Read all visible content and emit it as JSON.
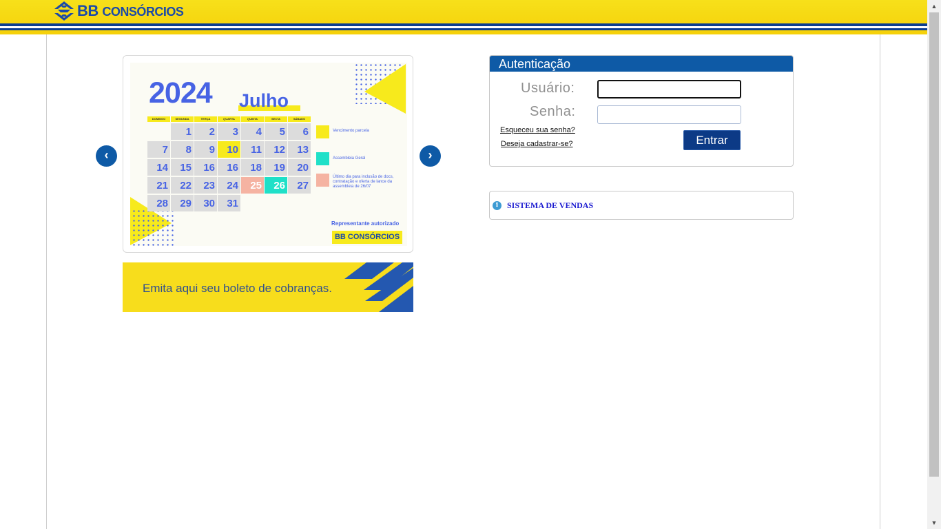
{
  "header": {
    "logo_text_main": "BB ",
    "logo_text_sc": "CONSÓRCIOS",
    "logo_icon": "bb-logo-icon",
    "brand_yellow": "#f5d10a",
    "brand_blue": "#0b3d91"
  },
  "carousel": {
    "prev_label": "‹",
    "next_label": "›",
    "calendar": {
      "year": "2024",
      "month": "Julho",
      "weekdays": [
        "DOMINGO",
        "SEGUNDA",
        "TERÇA",
        "QUARTA",
        "QUINTA",
        "SEXTA",
        "SÁBADO"
      ],
      "weeks": [
        [
          "",
          "1",
          "2",
          "3",
          "4",
          "5",
          "6"
        ],
        [
          "7",
          "8",
          "9",
          "10",
          "11",
          "12",
          "13"
        ],
        [
          "14",
          "15",
          "16",
          "16",
          "18",
          "19",
          "20"
        ],
        [
          "21",
          "22",
          "23",
          "24",
          "25",
          "26",
          "27"
        ],
        [
          "28",
          "29",
          "30",
          "31",
          "",
          "",
          ""
        ]
      ],
      "legend": [
        {
          "text": "Vencimento parcela",
          "color": "#f7ea1c"
        },
        {
          "text": "Assembleia Geral",
          "color": "#1fe0c8"
        },
        {
          "text": "Último dia para inclusão de docs, contratação e oferta de lance da assembleia de 26/07",
          "color": "#f5b3a2"
        }
      ],
      "representative": "Representante autorizado",
      "rep_logo": "BB CONSÓRCIOS"
    }
  },
  "boleto": {
    "text": "Emita aqui seu boleto de cobranças."
  },
  "auth": {
    "title": "Autenticação",
    "user_label": "Usuário:",
    "user_value": "",
    "password_label": "Senha:",
    "password_value": "",
    "forgot_link": "Esqueceu sua senha?",
    "register_link": "Deseja cadastrar-se?",
    "submit_label": "Entrar"
  },
  "sales": {
    "icon": "info-icon",
    "label": "SISTEMA DE VENDAS"
  }
}
